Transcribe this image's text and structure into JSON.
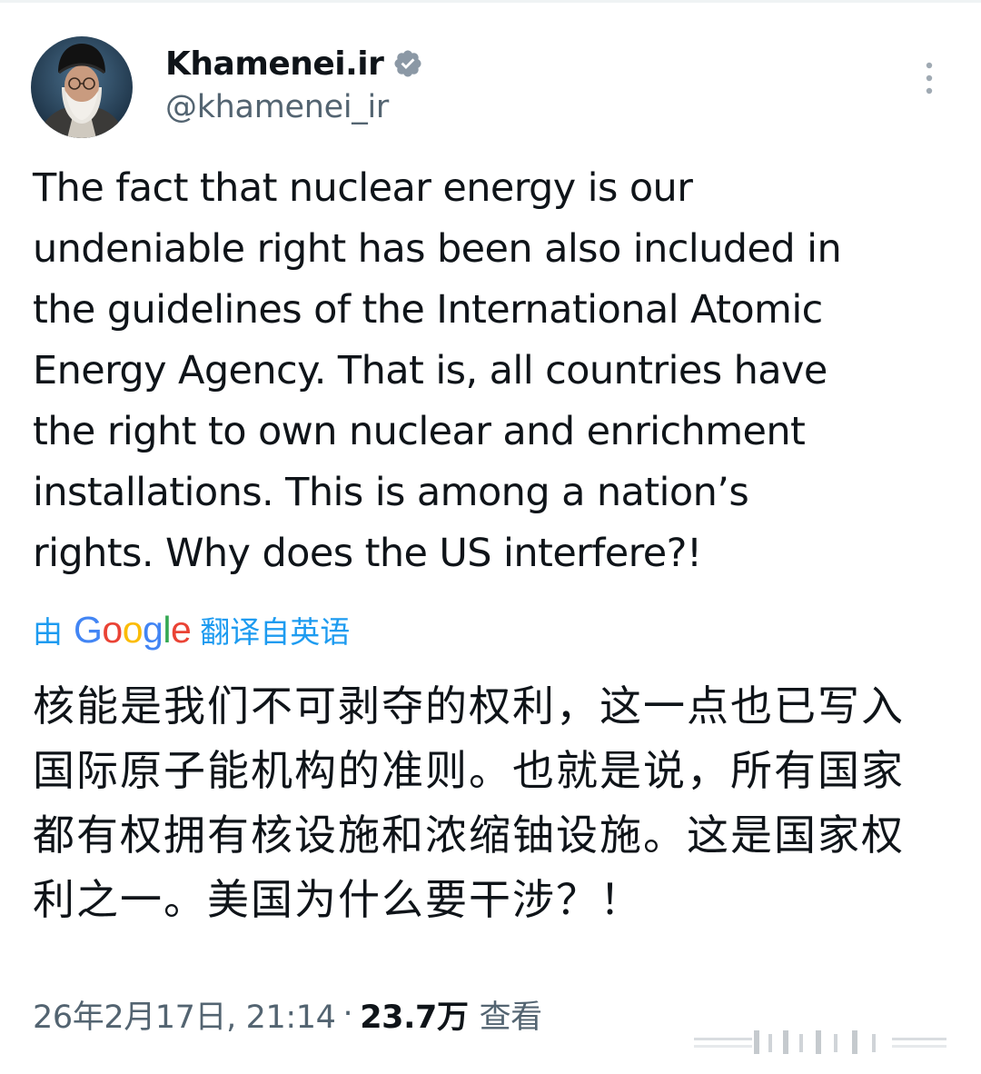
{
  "author": {
    "display_name": "Khamenei.ir",
    "handle": "@khamenei_ir",
    "verified": true
  },
  "tweet": {
    "text": "The fact that nuclear energy is our\nundeniable right has been also included in\nthe guidelines of the International Atomic\nEnergy Agency. That is, all countries have\nthe right to own nuclear and enrichment\ninstallations. This is among a nation’s\nrights. Why does the US interfere?!"
  },
  "translation": {
    "prefix": "由",
    "provider": "Google",
    "suffix": "翻译自英语",
    "text": "核能是我们不可剥夺的权利，这一点也已写入国际原子能机构的准则。也就是说，所有国家都有权拥有核设施和浓缩铀设施。这是国家权利之一。美国为什么要干涉？！"
  },
  "meta": {
    "timestamp": "26年2月17日, 21:14",
    "separator": "·",
    "views_count": "23.7万",
    "views_label": "查看"
  },
  "icons": {
    "verified": "verified-badge-icon",
    "more": "more-options-icon"
  },
  "colors": {
    "accent": "#1d9bf0",
    "text_primary": "#0f1419",
    "text_secondary": "#536471",
    "google_blue": "#4285f4",
    "google_red": "#ea4335",
    "google_yellow": "#fbbc05",
    "google_green": "#34a853"
  }
}
